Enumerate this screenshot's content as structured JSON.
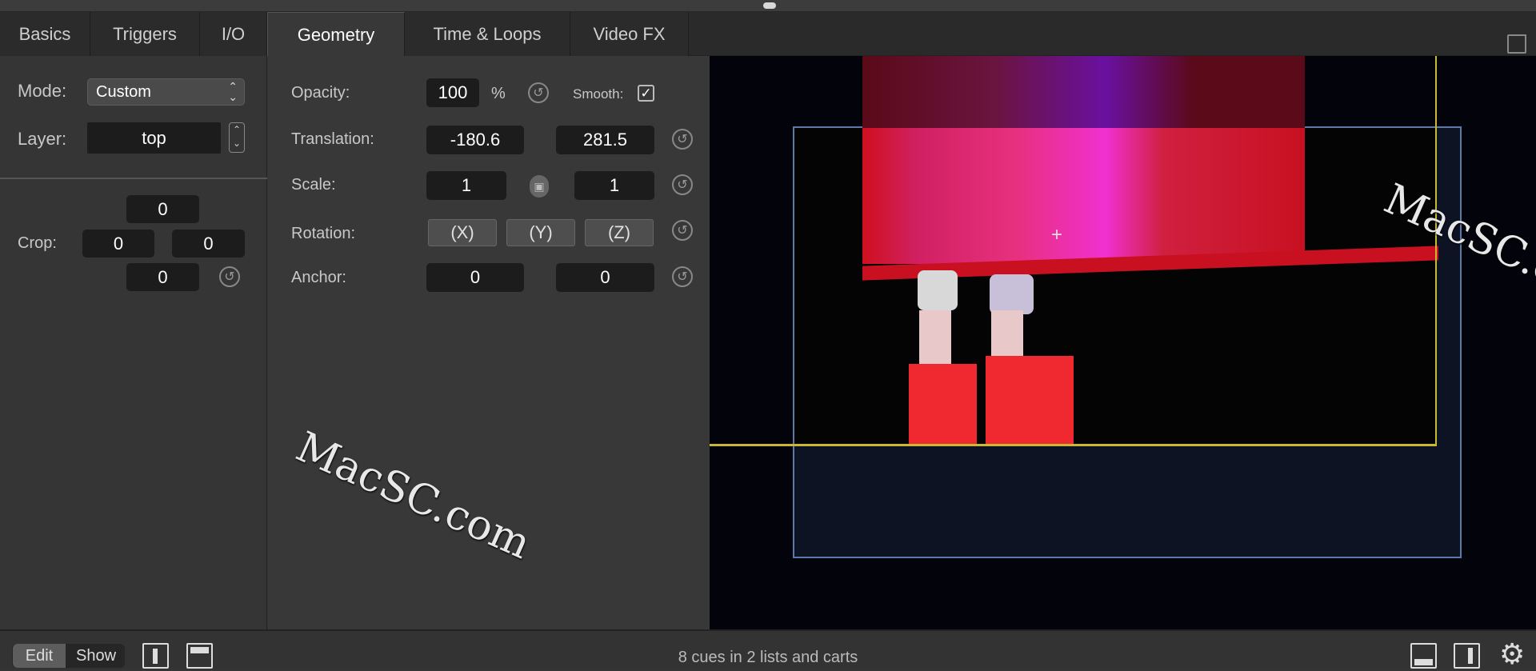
{
  "tabs": [
    {
      "label": "Basics",
      "active": false
    },
    {
      "label": "Triggers",
      "active": false
    },
    {
      "label": "I/O",
      "active": false
    },
    {
      "label": "Geometry",
      "active": true
    },
    {
      "label": "Time & Loops",
      "active": false
    },
    {
      "label": "Video FX",
      "active": false
    }
  ],
  "left": {
    "mode_label": "Mode:",
    "mode_value": "Custom",
    "layer_label": "Layer:",
    "layer_value": "top",
    "crop_label": "Crop:",
    "crop": {
      "top": "0",
      "left": "0",
      "right": "0",
      "bottom": "0"
    }
  },
  "geometry": {
    "opacity_label": "Opacity:",
    "opacity_value": "100",
    "opacity_unit": "%",
    "smooth_label": "Smooth:",
    "smooth_checked": true,
    "translation_label": "Translation:",
    "translation_x": "-180.6",
    "translation_y": "281.5",
    "scale_label": "Scale:",
    "scale_x": "1",
    "scale_y": "1",
    "rotation_label": "Rotation:",
    "rotation_x": "(X)",
    "rotation_y": "(Y)",
    "rotation_z": "(Z)",
    "anchor_label": "Anchor:",
    "anchor_x": "0",
    "anchor_y": "0"
  },
  "preview": {
    "stage_color": "#c8b834",
    "bounds_color": "#5b7aa8"
  },
  "bottom": {
    "edit_label": "Edit",
    "show_label": "Show",
    "status": "8 cues in 2 lists and carts"
  },
  "watermark": "MacSC.com"
}
